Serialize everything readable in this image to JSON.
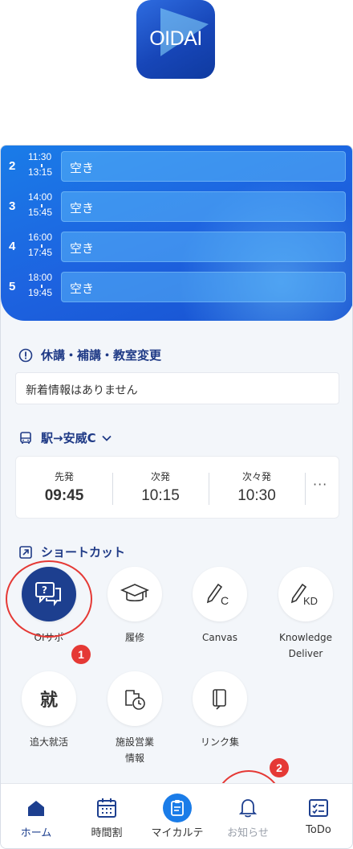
{
  "app": {
    "logo_text": "OIDAI"
  },
  "timetable": {
    "periods": [
      {
        "num": "2",
        "start": "11:30",
        "end": "13:15",
        "status": "空き"
      },
      {
        "num": "3",
        "start": "14:00",
        "end": "15:45",
        "status": "空き"
      },
      {
        "num": "4",
        "start": "16:00",
        "end": "17:45",
        "status": "空き"
      },
      {
        "num": "5",
        "start": "18:00",
        "end": "19:45",
        "status": "空き"
      }
    ]
  },
  "notices": {
    "title": "休講・補講・教室変更",
    "message": "新着情報はありません"
  },
  "bus": {
    "route": "駅→安威C",
    "columns": [
      {
        "label": "先発",
        "time": "09:45"
      },
      {
        "label": "次発",
        "time": "10:15"
      },
      {
        "label": "次々発",
        "time": "10:30"
      }
    ],
    "more": "···"
  },
  "shortcuts": {
    "title": "ショートカット",
    "items": [
      {
        "label": "OIサポ",
        "icon": "chat-question-icon"
      },
      {
        "label": "履修",
        "icon": "graduation-cap-icon"
      },
      {
        "label": "Canvas",
        "icon": "pencil-c-icon",
        "glyph": "C"
      },
      {
        "label": "Knowledge\nDeliver",
        "icon": "pencil-kd-icon",
        "glyph": "KD"
      },
      {
        "label": "追大就活",
        "icon": "job-kanji-icon",
        "glyph": "就"
      },
      {
        "label": "施設営業\n情報",
        "icon": "building-clock-icon"
      },
      {
        "label": "リンク集",
        "icon": "notebook-icon"
      }
    ]
  },
  "annotations": {
    "badge1": "1",
    "badge2": "2"
  },
  "nav": {
    "items": [
      {
        "label": "ホーム",
        "icon": "home-icon"
      },
      {
        "label": "時間割",
        "icon": "calendar-icon"
      },
      {
        "label": "マイカルテ",
        "icon": "clipboard-icon"
      },
      {
        "label": "お知らせ",
        "icon": "bell-icon"
      },
      {
        "label": "ToDo",
        "icon": "checklist-icon"
      }
    ]
  },
  "colors": {
    "primary": "#1d3f8f",
    "accent": "#1a7ce8",
    "annotation": "#e53935"
  }
}
